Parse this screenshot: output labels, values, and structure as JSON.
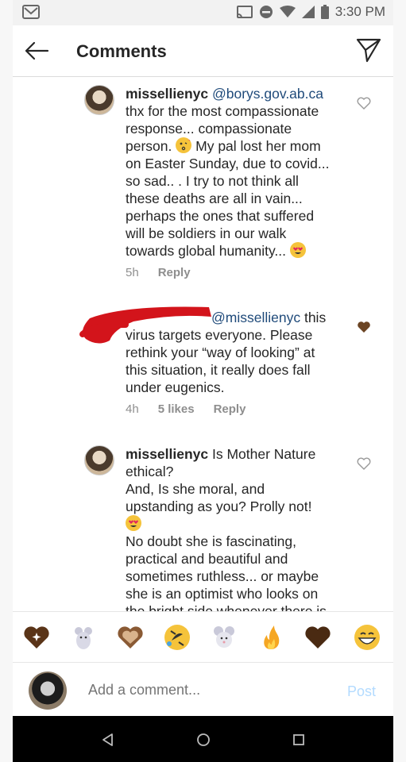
{
  "status_bar": {
    "time": "3:30 PM",
    "icons": [
      "gmail-icon",
      "cast-icon",
      "dnd-icon",
      "wifi-icon",
      "signal-icon",
      "battery-icon"
    ]
  },
  "header": {
    "title": "Comments",
    "back_icon": "arrow-left-icon",
    "send_icon": "direct-send-icon"
  },
  "comments": [
    {
      "username": "missellienyc",
      "mention": "@borys.gov.ab.ca",
      "lines": [
        "thx for the most compassionate",
        "response... compassionate",
        "person.",
        "My  pal lost her mom",
        "on Easter Sunday, due to covid...",
        "so sad.. . I try to not think all",
        "these deaths are all in vain...",
        "perhaps the ones that suffered",
        "will be soldiers in our walk",
        "towards global humanity..."
      ],
      "time": "5h",
      "reply": "Reply",
      "liked": false
    },
    {
      "username": "",
      "mention": "@missellienyc",
      "text_after_mention": " this",
      "lines": [
        "virus targets everyone. Please",
        "rethink your “way of looking” at",
        "this situation, it really does fall",
        "under eugenics."
      ],
      "time": "4h",
      "likes": "5 likes",
      "reply": "Reply",
      "liked": true
    },
    {
      "username": "missellienyc",
      "first_line": " Is Mother Nature",
      "lines": [
        "ethical?",
        "And, Is she moral, and",
        "upstanding as you? Prolly not!",
        "",
        "No doubt she is fascinating,",
        "practical and beautiful and",
        "sometimes ruthless... or maybe",
        "she  is an optimist who looks on",
        "the bright side whenever there is"
      ],
      "liked": false
    }
  ],
  "emoji_bar": [
    "sparkling-heart-icon",
    "mouse-icon",
    "heart-icon",
    "rolling-laugh-icon",
    "mouse-face-icon",
    "fire-icon",
    "brown-heart-icon",
    "grin-icon"
  ],
  "composer": {
    "placeholder": "Add a comment...",
    "post_label": "Post"
  },
  "colors": {
    "mention": "#1f4a7a",
    "post_disabled": "#b3dbff",
    "heart_liked": "#6b4423",
    "emoji": "#f5c33b"
  }
}
